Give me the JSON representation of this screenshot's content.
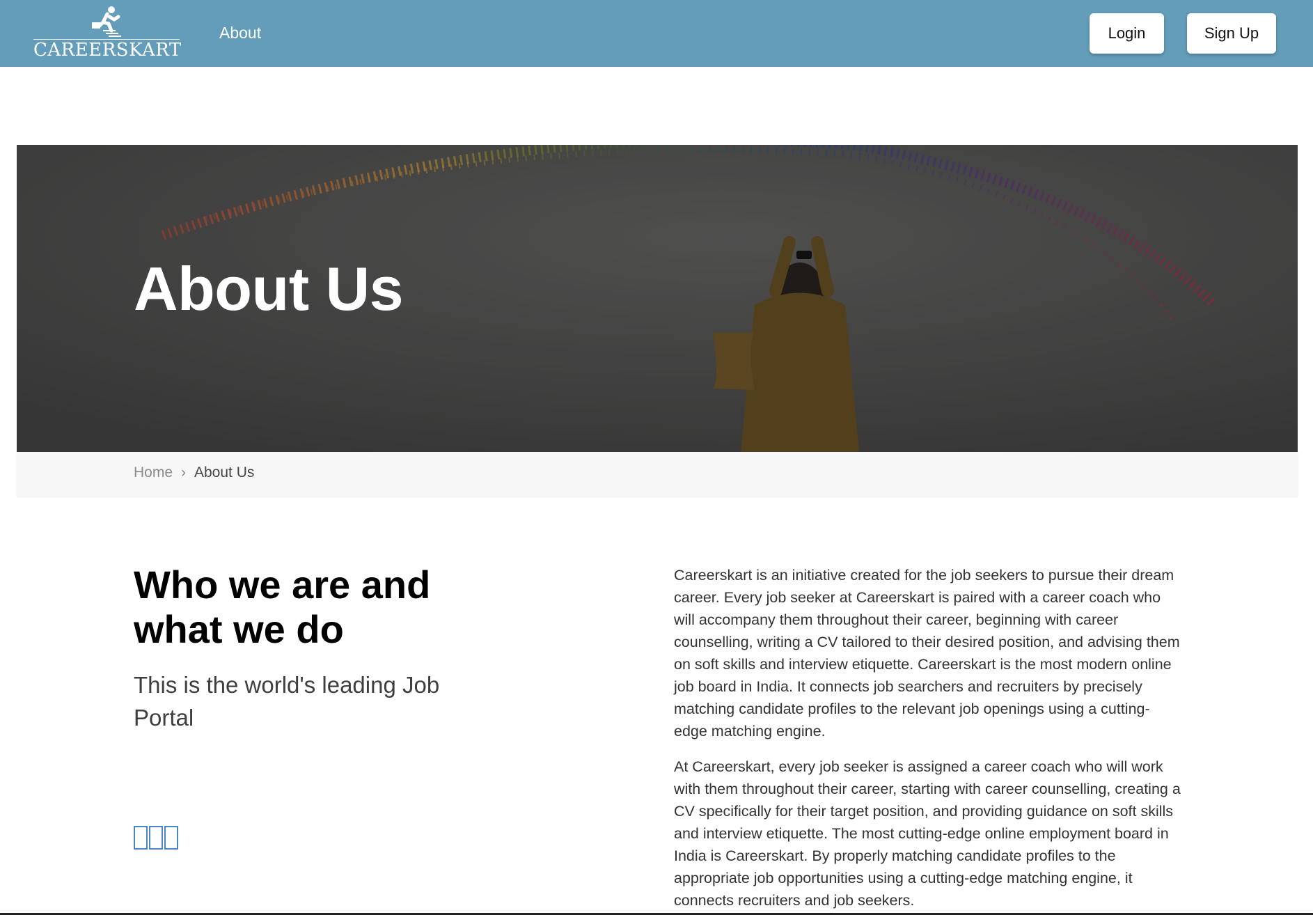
{
  "header": {
    "logo_text": "CAREERSKART",
    "nav": {
      "about_label": "About"
    },
    "login_label": "Login",
    "signup_label": "Sign Up",
    "background_color": "#639db9"
  },
  "hero": {
    "title": "About Us"
  },
  "breadcrumb": {
    "home_label": "Home",
    "separator": "›",
    "current_label": "About Us"
  },
  "content": {
    "heading": "Who we are and what we do",
    "tagline": "This is the world's leading Job Portal",
    "paragraphs": [
      "Careerskart is an initiative created for the job seekers to pursue their dream career. Every job seeker at Careerskart is paired with a career coach who will accompany them throughout their career, beginning with career counselling, writing a CV tailored to their desired position, and advising them on soft skills and interview etiquette. Careerskart is the most modern online job board in India. It connects job searchers and recruiters by precisely matching candidate profiles to the relevant job openings using a cutting-edge matching engine.",
      "At Careerskart, every job seeker is assigned a career coach who will work with them throughout their career, starting with career counselling, creating a CV specifically for their target position, and providing guidance on soft skills and interview etiquette. The most cutting-edge online employment board in India is Careerskart. By properly matching candidate profiles to the appropriate job opportunities using a cutting-edge matching engine, it connects recruiters and job seekers."
    ],
    "social_icons": [
      "missing-glyph-icon",
      "missing-glyph-icon",
      "missing-glyph-icon"
    ]
  }
}
